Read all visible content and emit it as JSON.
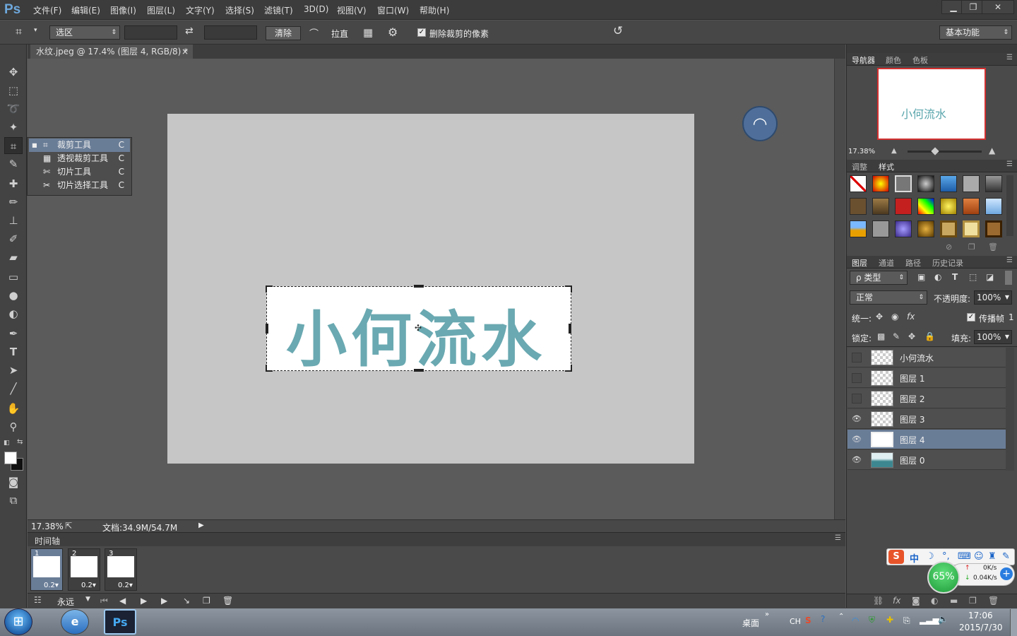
{
  "app": {
    "logo": "Ps",
    "menus": [
      "文件(F)",
      "编辑(E)",
      "图像(I)",
      "图层(L)",
      "文字(Y)",
      "选择(S)",
      "滤镜(T)",
      "3D(D)",
      "视图(V)",
      "窗口(W)",
      "帮助(H)"
    ],
    "window_buttons": [
      "▁",
      "❐",
      "✕"
    ]
  },
  "options": {
    "ratio_select": "选区",
    "clear_label": "清除",
    "straighten_label": "拉直",
    "delete_cropped_label": "删除裁剪的像素",
    "workspace": "基本功能"
  },
  "document": {
    "tab_title": "水纹.jpeg @ 17.4% (图层 4, RGB/8) *",
    "tab_close": "×",
    "watermark_text": "小何流水"
  },
  "flyout": {
    "items": [
      {
        "label": "裁剪工具",
        "key": "C"
      },
      {
        "label": "透视裁剪工具",
        "key": "C"
      },
      {
        "label": "切片工具",
        "key": "C"
      },
      {
        "label": "切片选择工具",
        "key": "C"
      }
    ]
  },
  "status": {
    "zoom": "17.38%",
    "doc_info": "文档:34.9M/54.7M"
  },
  "timeline": {
    "title": "时间轴",
    "frames": [
      {
        "num": "1",
        "delay": "0.2▾"
      },
      {
        "num": "2",
        "delay": "0.2▾"
      },
      {
        "num": "3",
        "delay": "0.2▾"
      }
    ],
    "loop": "永远"
  },
  "navigator": {
    "tabs": [
      "导航器",
      "颜色",
      "色板"
    ],
    "thumb_text": "小何流水",
    "zoom": "17.38%"
  },
  "styles_panel": {
    "tabs": [
      "调整",
      "样式"
    ]
  },
  "layers_panel": {
    "tabs": [
      "图层",
      "通道",
      "路径",
      "历史记录"
    ],
    "filter": "ρ 类型",
    "blend_mode": "正常",
    "opacity_label": "不透明度:",
    "opacity_value": "100%",
    "unify_label": "统一:",
    "propagate_label": "传播帧",
    "propagate_value": "1",
    "lock_label": "锁定:",
    "fill_label": "填充:",
    "fill_value": "100%",
    "layers": [
      {
        "name": "小何流水",
        "visible": false,
        "selected": false
      },
      {
        "name": "图层 1",
        "visible": false,
        "selected": false
      },
      {
        "name": "图层 2",
        "visible": false,
        "selected": false
      },
      {
        "name": "图层 3",
        "visible": true,
        "selected": false
      },
      {
        "name": "图层 4",
        "visible": true,
        "selected": true
      },
      {
        "name": "图层 0",
        "visible": true,
        "selected": false
      }
    ]
  },
  "ime": {
    "logo": "S",
    "mode": "中",
    "speed_percent": "65%",
    "upload": "0K/s",
    "download": "0.04K/s"
  },
  "taskbar": {
    "ps_label": "Ps",
    "desktop_label": "桌面",
    "lang": "CH",
    "time": "17:06",
    "date": "2015/7/30"
  }
}
